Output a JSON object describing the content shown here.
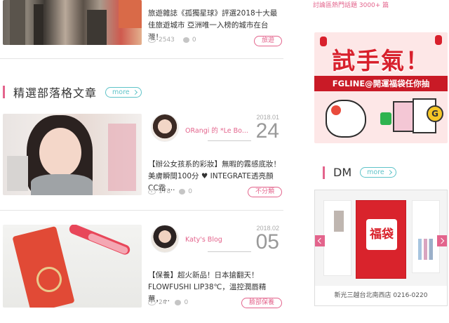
{
  "top_article": {
    "excerpt": "旅遊雜誌《孤獨星球》評選2018十大最佳旅遊城市 亞洲唯一入榜的城市在台灣！",
    "views": "2543",
    "comments": "0",
    "tag": "旅遊"
  },
  "section": {
    "title": "精選部落格文章",
    "more_label": "more"
  },
  "posts": [
    {
      "author": "ORangi 的 *Le Bo...",
      "date_ym": "2018.01",
      "date_day": "24",
      "excerpt": "【辦公女孩系的彩妝】無暇的霧感底妝！美膚瞬間100分 ♥ INTEGRATE透亮顏CC霜 ...",
      "views": "178",
      "comments": "0",
      "tag": "不分類"
    },
    {
      "author": "Katy's Blog",
      "date_ym": "2018.02",
      "date_day": "05",
      "excerpt": "【保養】超火新品！日本搶翻天！FLOWFUSHI LIP38℃，溫控潤唇精華，...",
      "views": "24",
      "comments": "0",
      "tag": "臉部保養"
    }
  ],
  "sidebar": {
    "top_text": "討論區熱門話題 3000+ 篇",
    "banner": {
      "title": "試手氣！",
      "subtitle": "FGLINE@開運福袋任你抽",
      "coin_letter": "G"
    },
    "dm": {
      "title": "DM",
      "more_label": "more",
      "center_page_text": "福袋",
      "caption": "新光三越台北南西店 0216-0220"
    }
  },
  "colors": {
    "accent_pink": "#e3648c",
    "accent_teal": "#5ec3c8",
    "banner_red": "#d8202c"
  }
}
